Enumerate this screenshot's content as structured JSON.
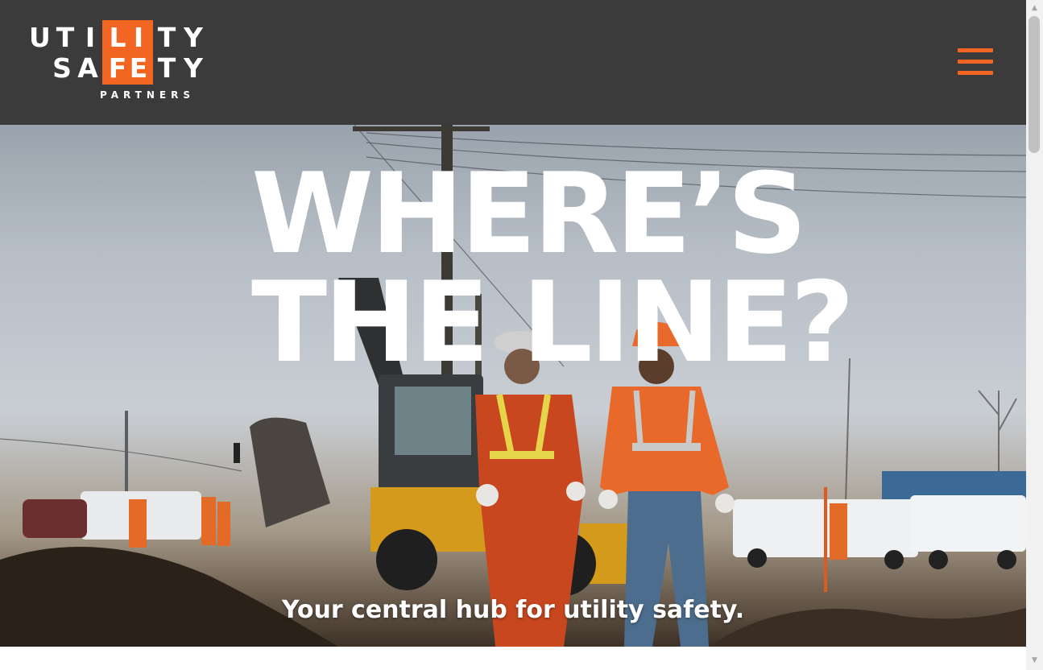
{
  "header": {
    "logo": {
      "line1": [
        "U",
        "T",
        "I",
        "L",
        "I",
        "T",
        "Y"
      ],
      "line2": [
        "S",
        "A",
        "F",
        "E",
        "T",
        "Y"
      ],
      "line3": "PARTNERS",
      "brand_color": "#f26522"
    },
    "menu_icon": "hamburger-menu-icon"
  },
  "hero": {
    "headline_line1": "WHERE’S",
    "headline_line2": "THE LINE?",
    "tagline": "Your central hub for utility safety."
  },
  "scrollbar": {
    "up_arrow": "▲",
    "down_arrow": "▼"
  }
}
